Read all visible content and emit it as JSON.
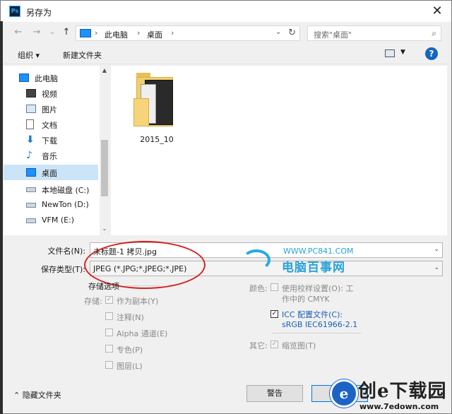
{
  "window": {
    "title": "另存为",
    "app_icon_text": "Ps",
    "close_glyph": "✕"
  },
  "nav": {
    "back_glyph": "←",
    "forward_glyph": "→",
    "recent_glyph": "⌄",
    "up_glyph": "↑",
    "breadcrumb_root": "此电脑",
    "breadcrumb_current": "桌面",
    "sep": "›",
    "refresh_glyph": "↻",
    "search_placeholder": "搜索\"桌面\"",
    "search_glyph": "⌕"
  },
  "toolbar": {
    "organize": "组织 ▾",
    "new_folder": "新建文件夹",
    "help": "?",
    "view_dd": "▼"
  },
  "sidebar": {
    "items": [
      {
        "label": "此电脑",
        "icon": "computer-icon"
      },
      {
        "label": "视频",
        "icon": "video-icon"
      },
      {
        "label": "图片",
        "icon": "picture-icon"
      },
      {
        "label": "文档",
        "icon": "document-icon"
      },
      {
        "label": "下载",
        "icon": "download-icon"
      },
      {
        "label": "音乐",
        "icon": "music-icon"
      },
      {
        "label": "桌面",
        "icon": "desktop-icon",
        "selected": true
      },
      {
        "label": "本地磁盘 (C:)",
        "icon": "drive-icon"
      },
      {
        "label": "NewTon (D:)",
        "icon": "drive-icon"
      },
      {
        "label": "VFM (E:)",
        "icon": "drive-icon"
      }
    ],
    "scroll_up": "▲",
    "scroll_down": "⌄"
  },
  "files": [
    {
      "name": "2015_10",
      "type": "folder"
    }
  ],
  "form": {
    "filename_label": "文件名(N):",
    "filename_value": "未标题-1 拷贝.jpg",
    "type_label": "保存类型(T):",
    "type_value": "JPEG (*.JPG;*.JPEG;*.JPE)",
    "dd": "⌄"
  },
  "options": {
    "section_title": "存储选项",
    "storage_label": "存储:",
    "as_copy": "作为副本(Y)",
    "notes": "注释(N)",
    "alpha": "Alpha 通道(E)",
    "spot": "专色(P)",
    "layers": "图层(L)",
    "color_label": "颜色:",
    "proof_line1": "使用校样设置(O): 工",
    "proof_line2": "作中的 CMYK",
    "icc_line1": "ICC 配置文件(C):",
    "icc_line2": "sRGB IEC61966-2.1",
    "other_label": "其它:",
    "thumbnail": "缩览图(T)",
    "check": "✓"
  },
  "footer": {
    "hide_folders": "隐藏文件夹",
    "warning_btn": "警告",
    "save_btn": ""
  },
  "watermarks": {
    "pc841_url": "WWW.PC841.COM",
    "pc841_name": "电脑百事网",
    "e7_title": "创e下载园",
    "e7_url": "www.7edown.com",
    "e7_letter": "e"
  }
}
